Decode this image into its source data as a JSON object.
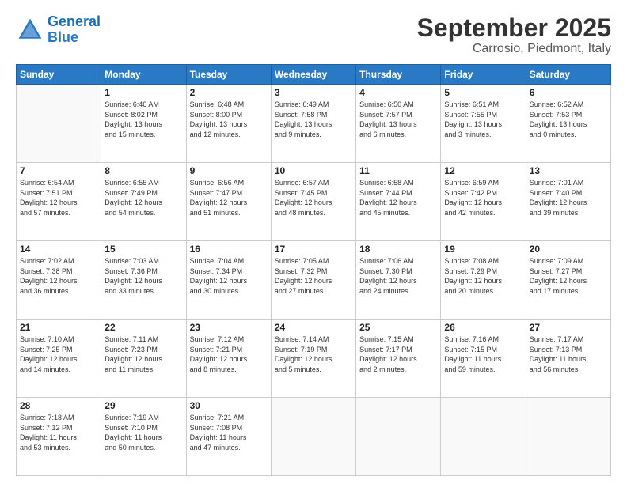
{
  "header": {
    "logo_line1": "General",
    "logo_line2": "Blue",
    "month": "September 2025",
    "location": "Carrosio, Piedmont, Italy"
  },
  "weekdays": [
    "Sunday",
    "Monday",
    "Tuesday",
    "Wednesday",
    "Thursday",
    "Friday",
    "Saturday"
  ],
  "weeks": [
    [
      {
        "day": "",
        "info": ""
      },
      {
        "day": "1",
        "info": "Sunrise: 6:46 AM\nSunset: 8:02 PM\nDaylight: 13 hours\nand 15 minutes."
      },
      {
        "day": "2",
        "info": "Sunrise: 6:48 AM\nSunset: 8:00 PM\nDaylight: 13 hours\nand 12 minutes."
      },
      {
        "day": "3",
        "info": "Sunrise: 6:49 AM\nSunset: 7:58 PM\nDaylight: 13 hours\nand 9 minutes."
      },
      {
        "day": "4",
        "info": "Sunrise: 6:50 AM\nSunset: 7:57 PM\nDaylight: 13 hours\nand 6 minutes."
      },
      {
        "day": "5",
        "info": "Sunrise: 6:51 AM\nSunset: 7:55 PM\nDaylight: 13 hours\nand 3 minutes."
      },
      {
        "day": "6",
        "info": "Sunrise: 6:52 AM\nSunset: 7:53 PM\nDaylight: 13 hours\nand 0 minutes."
      }
    ],
    [
      {
        "day": "7",
        "info": "Sunrise: 6:54 AM\nSunset: 7:51 PM\nDaylight: 12 hours\nand 57 minutes."
      },
      {
        "day": "8",
        "info": "Sunrise: 6:55 AM\nSunset: 7:49 PM\nDaylight: 12 hours\nand 54 minutes."
      },
      {
        "day": "9",
        "info": "Sunrise: 6:56 AM\nSunset: 7:47 PM\nDaylight: 12 hours\nand 51 minutes."
      },
      {
        "day": "10",
        "info": "Sunrise: 6:57 AM\nSunset: 7:45 PM\nDaylight: 12 hours\nand 48 minutes."
      },
      {
        "day": "11",
        "info": "Sunrise: 6:58 AM\nSunset: 7:44 PM\nDaylight: 12 hours\nand 45 minutes."
      },
      {
        "day": "12",
        "info": "Sunrise: 6:59 AM\nSunset: 7:42 PM\nDaylight: 12 hours\nand 42 minutes."
      },
      {
        "day": "13",
        "info": "Sunrise: 7:01 AM\nSunset: 7:40 PM\nDaylight: 12 hours\nand 39 minutes."
      }
    ],
    [
      {
        "day": "14",
        "info": "Sunrise: 7:02 AM\nSunset: 7:38 PM\nDaylight: 12 hours\nand 36 minutes."
      },
      {
        "day": "15",
        "info": "Sunrise: 7:03 AM\nSunset: 7:36 PM\nDaylight: 12 hours\nand 33 minutes."
      },
      {
        "day": "16",
        "info": "Sunrise: 7:04 AM\nSunset: 7:34 PM\nDaylight: 12 hours\nand 30 minutes."
      },
      {
        "day": "17",
        "info": "Sunrise: 7:05 AM\nSunset: 7:32 PM\nDaylight: 12 hours\nand 27 minutes."
      },
      {
        "day": "18",
        "info": "Sunrise: 7:06 AM\nSunset: 7:30 PM\nDaylight: 12 hours\nand 24 minutes."
      },
      {
        "day": "19",
        "info": "Sunrise: 7:08 AM\nSunset: 7:29 PM\nDaylight: 12 hours\nand 20 minutes."
      },
      {
        "day": "20",
        "info": "Sunrise: 7:09 AM\nSunset: 7:27 PM\nDaylight: 12 hours\nand 17 minutes."
      }
    ],
    [
      {
        "day": "21",
        "info": "Sunrise: 7:10 AM\nSunset: 7:25 PM\nDaylight: 12 hours\nand 14 minutes."
      },
      {
        "day": "22",
        "info": "Sunrise: 7:11 AM\nSunset: 7:23 PM\nDaylight: 12 hours\nand 11 minutes."
      },
      {
        "day": "23",
        "info": "Sunrise: 7:12 AM\nSunset: 7:21 PM\nDaylight: 12 hours\nand 8 minutes."
      },
      {
        "day": "24",
        "info": "Sunrise: 7:14 AM\nSunset: 7:19 PM\nDaylight: 12 hours\nand 5 minutes."
      },
      {
        "day": "25",
        "info": "Sunrise: 7:15 AM\nSunset: 7:17 PM\nDaylight: 12 hours\nand 2 minutes."
      },
      {
        "day": "26",
        "info": "Sunrise: 7:16 AM\nSunset: 7:15 PM\nDaylight: 11 hours\nand 59 minutes."
      },
      {
        "day": "27",
        "info": "Sunrise: 7:17 AM\nSunset: 7:13 PM\nDaylight: 11 hours\nand 56 minutes."
      }
    ],
    [
      {
        "day": "28",
        "info": "Sunrise: 7:18 AM\nSunset: 7:12 PM\nDaylight: 11 hours\nand 53 minutes."
      },
      {
        "day": "29",
        "info": "Sunrise: 7:19 AM\nSunset: 7:10 PM\nDaylight: 11 hours\nand 50 minutes."
      },
      {
        "day": "30",
        "info": "Sunrise: 7:21 AM\nSunset: 7:08 PM\nDaylight: 11 hours\nand 47 minutes."
      },
      {
        "day": "",
        "info": ""
      },
      {
        "day": "",
        "info": ""
      },
      {
        "day": "",
        "info": ""
      },
      {
        "day": "",
        "info": ""
      }
    ]
  ]
}
